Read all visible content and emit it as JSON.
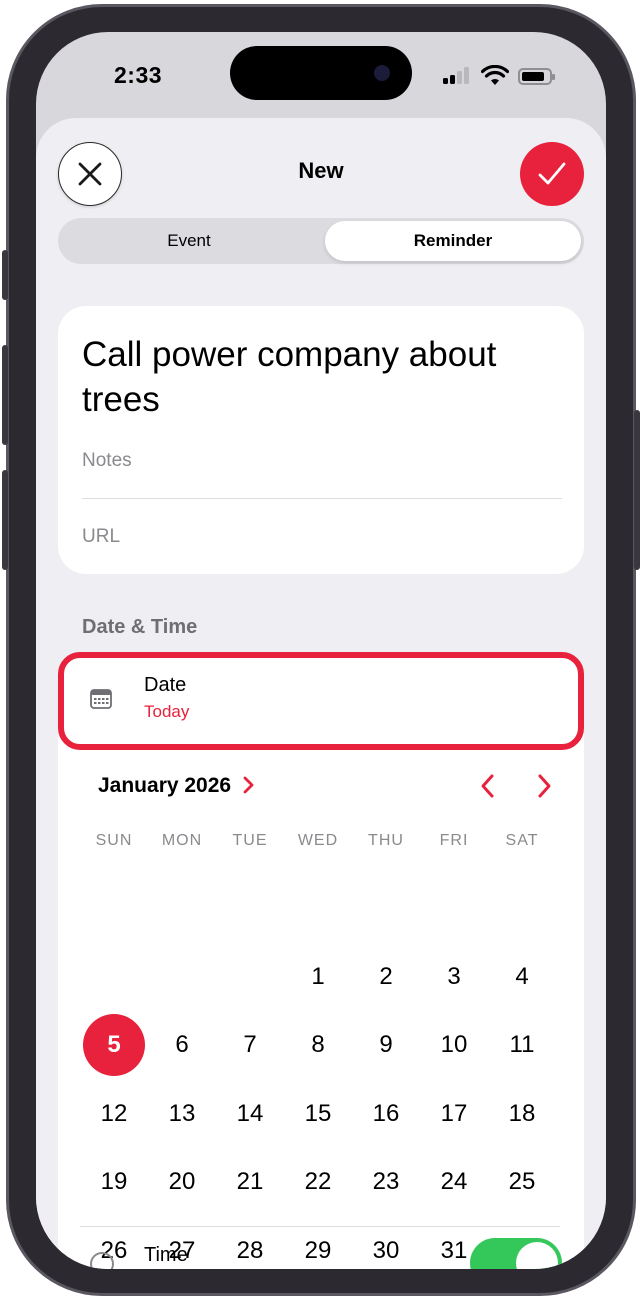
{
  "status_bar": {
    "time": "2:33"
  },
  "header": {
    "title": "New",
    "close_icon": "close-icon",
    "confirm_icon": "checkmark-icon"
  },
  "segmented": {
    "options": [
      "Event",
      "Reminder"
    ],
    "selected": "Reminder"
  },
  "reminder": {
    "title": "Call power company about trees",
    "notes_placeholder": "Notes",
    "url_placeholder": "URL"
  },
  "date_time": {
    "section_header": "Date & Time",
    "date_label": "Date",
    "date_value": "Today",
    "time_label": "Time",
    "time_toggle_on": true
  },
  "calendar": {
    "month": "January 2026",
    "weekdays": [
      "SUN",
      "MON",
      "TUE",
      "WED",
      "THU",
      "FRI",
      "SAT"
    ],
    "days": [
      "1",
      "2",
      "3",
      "4",
      "5",
      "6",
      "7",
      "8",
      "9",
      "10",
      "11",
      "12",
      "13",
      "14",
      "15",
      "16",
      "17",
      "18",
      "19",
      "20",
      "21",
      "22",
      "23",
      "24",
      "25",
      "26",
      "27",
      "28",
      "29",
      "30",
      "31"
    ],
    "first_weekday_index": 4,
    "selected_day": "5"
  },
  "colors": {
    "accent": "#e8213c",
    "toggle_on": "#34c759"
  }
}
